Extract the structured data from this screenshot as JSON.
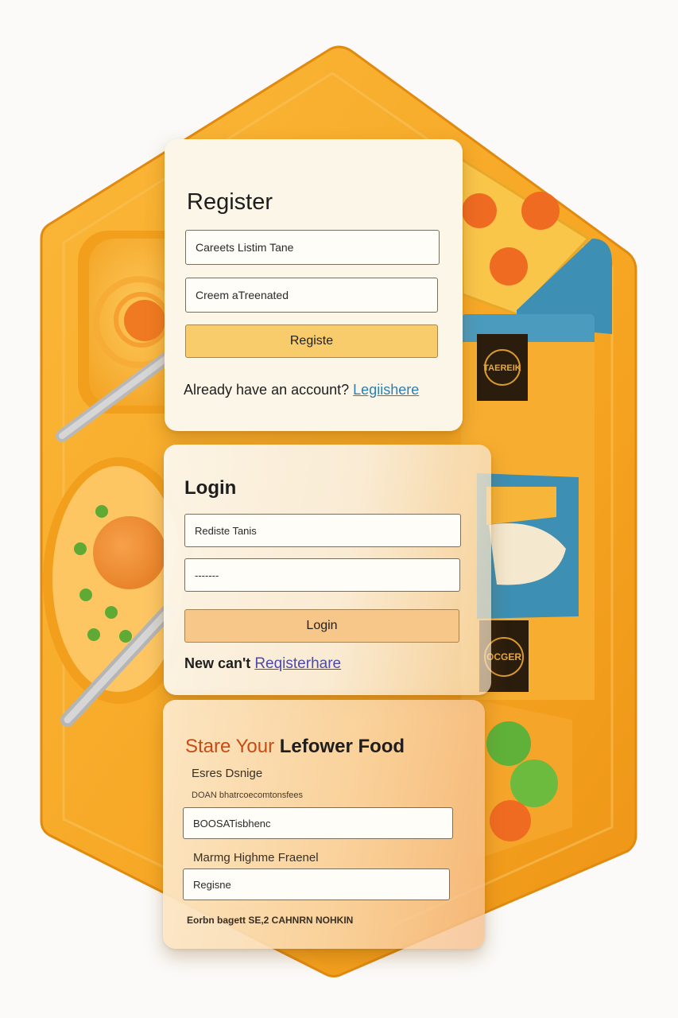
{
  "register": {
    "title": "Register",
    "field_1_value": "Careets Listim Tane",
    "field_2_value": "Creem aTreenated",
    "button_label": "Registe",
    "footer_text": "Already have an account?",
    "footer_link": "Legiishere"
  },
  "login": {
    "title": "Login",
    "username_value": "Rediste Tanis",
    "password_value": "-------",
    "button_label": "Login",
    "footer_text": "New can't",
    "footer_link": "Reqisterhare"
  },
  "share": {
    "title_part_1": "Stare Your",
    "title_part_2": "Lefower Food",
    "label_1": "Esres Dsnige",
    "sub_label_1": "DOAN bhatrcoecomtonsfees",
    "field_1_value": "BOOSATisbhenc",
    "label_2": "Marmg Highme Fraenel",
    "field_2_value": "Regisne",
    "footer_text": "Eorbn bagett SE,2 CAHNRN NOHKIN"
  },
  "badges": {
    "top_badge": "TAEREIK",
    "bottom_badge": "OCGER"
  },
  "colors": {
    "tray_orange": "#f6a623",
    "tray_dark": "#e98e10",
    "accent_blue": "#3d8fb3",
    "register_button": "#f8cc6a",
    "login_button": "#f7c689",
    "link_blue": "#2c7fb0"
  }
}
